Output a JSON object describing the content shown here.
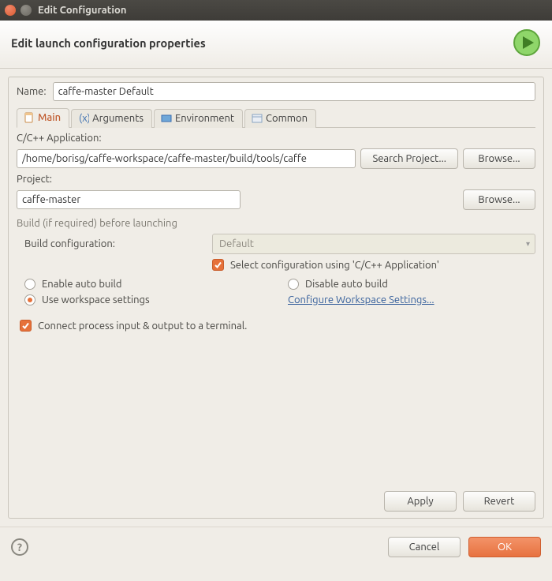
{
  "window": {
    "title": "Edit Configuration"
  },
  "header": {
    "title": "Edit launch configuration properties"
  },
  "name": {
    "label": "Name:",
    "value": "caffe-master Default"
  },
  "tabs": [
    {
      "label": "Main"
    },
    {
      "label": "Arguments"
    },
    {
      "label": "Environment"
    },
    {
      "label": "Common"
    }
  ],
  "main": {
    "appLabel": "C/C++ Application:",
    "appValue": "/home/borisg/caffe-workspace/caffe-master/build/tools/caffe",
    "searchProject": "Search Project...",
    "browse": "Browse...",
    "projectLabel": "Project:",
    "projectValue": "caffe-master",
    "buildSection": "Build (if required) before launching",
    "buildConfigLabel": "Build configuration:",
    "buildConfigValue": "Default",
    "selectConfigLabel": "Select configuration using 'C/C++ Application'",
    "enableAuto": "Enable auto build",
    "disableAuto": "Disable auto build",
    "useWorkspace": "Use workspace settings",
    "configureLink": "Configure Workspace Settings...",
    "connectTerminal": "Connect process input & output to a terminal."
  },
  "buttons": {
    "apply": "Apply",
    "revert": "Revert",
    "cancel": "Cancel",
    "ok": "OK"
  }
}
